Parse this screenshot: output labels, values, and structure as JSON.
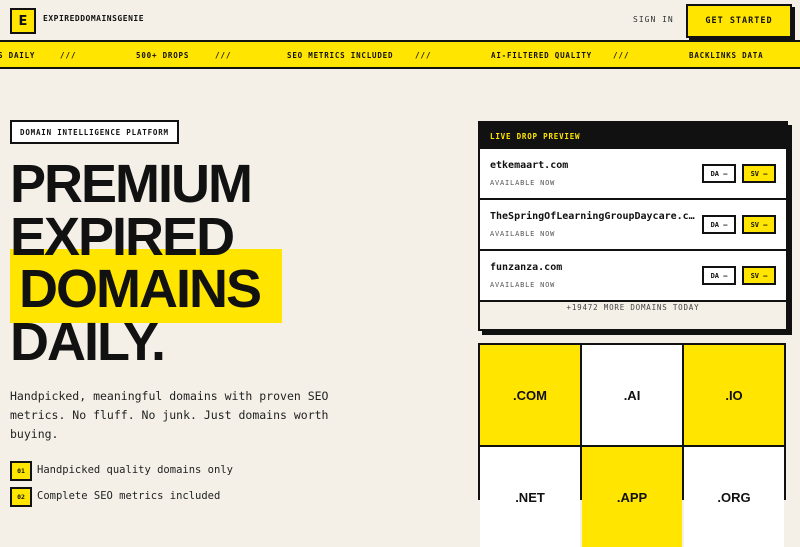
{
  "header": {
    "logo_letter": "E",
    "brand": "EXPIREDDOMAINSGENIE",
    "signin": "SIGN IN",
    "cta": "GET STARTED"
  },
  "ticker": {
    "items": [
      "S DAILY",
      "500+ DROPS",
      "SEO METRICS INCLUDED",
      "AI-FILTERED QUALITY",
      "BACKLINKS DATA"
    ],
    "separator": "///"
  },
  "hero": {
    "badge": "DOMAIN INTELLIGENCE PLATFORM",
    "line1": "PREMIUM",
    "line2": "EXPIRED",
    "line3": "DOMAINS",
    "line4": "DAILY.",
    "description": "Handpicked, meaningful domains with proven SEO metrics. No fluff. No junk. Just domains worth buying.",
    "features": [
      {
        "num": "01",
        "text": "Handpicked quality domains only"
      },
      {
        "num": "02",
        "text": "Complete SEO metrics included"
      }
    ]
  },
  "preview": {
    "title": "LIVE DROP PREVIEW",
    "rows": [
      {
        "domain": "etkemaart.com",
        "status": "AVAILABLE NOW",
        "da": "DA –",
        "sv": "SV –"
      },
      {
        "domain": "TheSpringOfLearningGroupDaycare.c…",
        "status": "AVAILABLE NOW",
        "da": "DA –",
        "sv": "SV –"
      },
      {
        "domain": "funzanza.com",
        "status": "AVAILABLE NOW",
        "da": "DA –",
        "sv": "SV –"
      }
    ],
    "more": "+19472 MORE DOMAINS TODAY"
  },
  "tlds": [
    ".COM",
    ".AI",
    ".IO",
    ".NET",
    ".APP",
    ".ORG"
  ],
  "colors": {
    "accent": "#ffe500",
    "ink": "#111111",
    "background": "#f4f0e8"
  }
}
